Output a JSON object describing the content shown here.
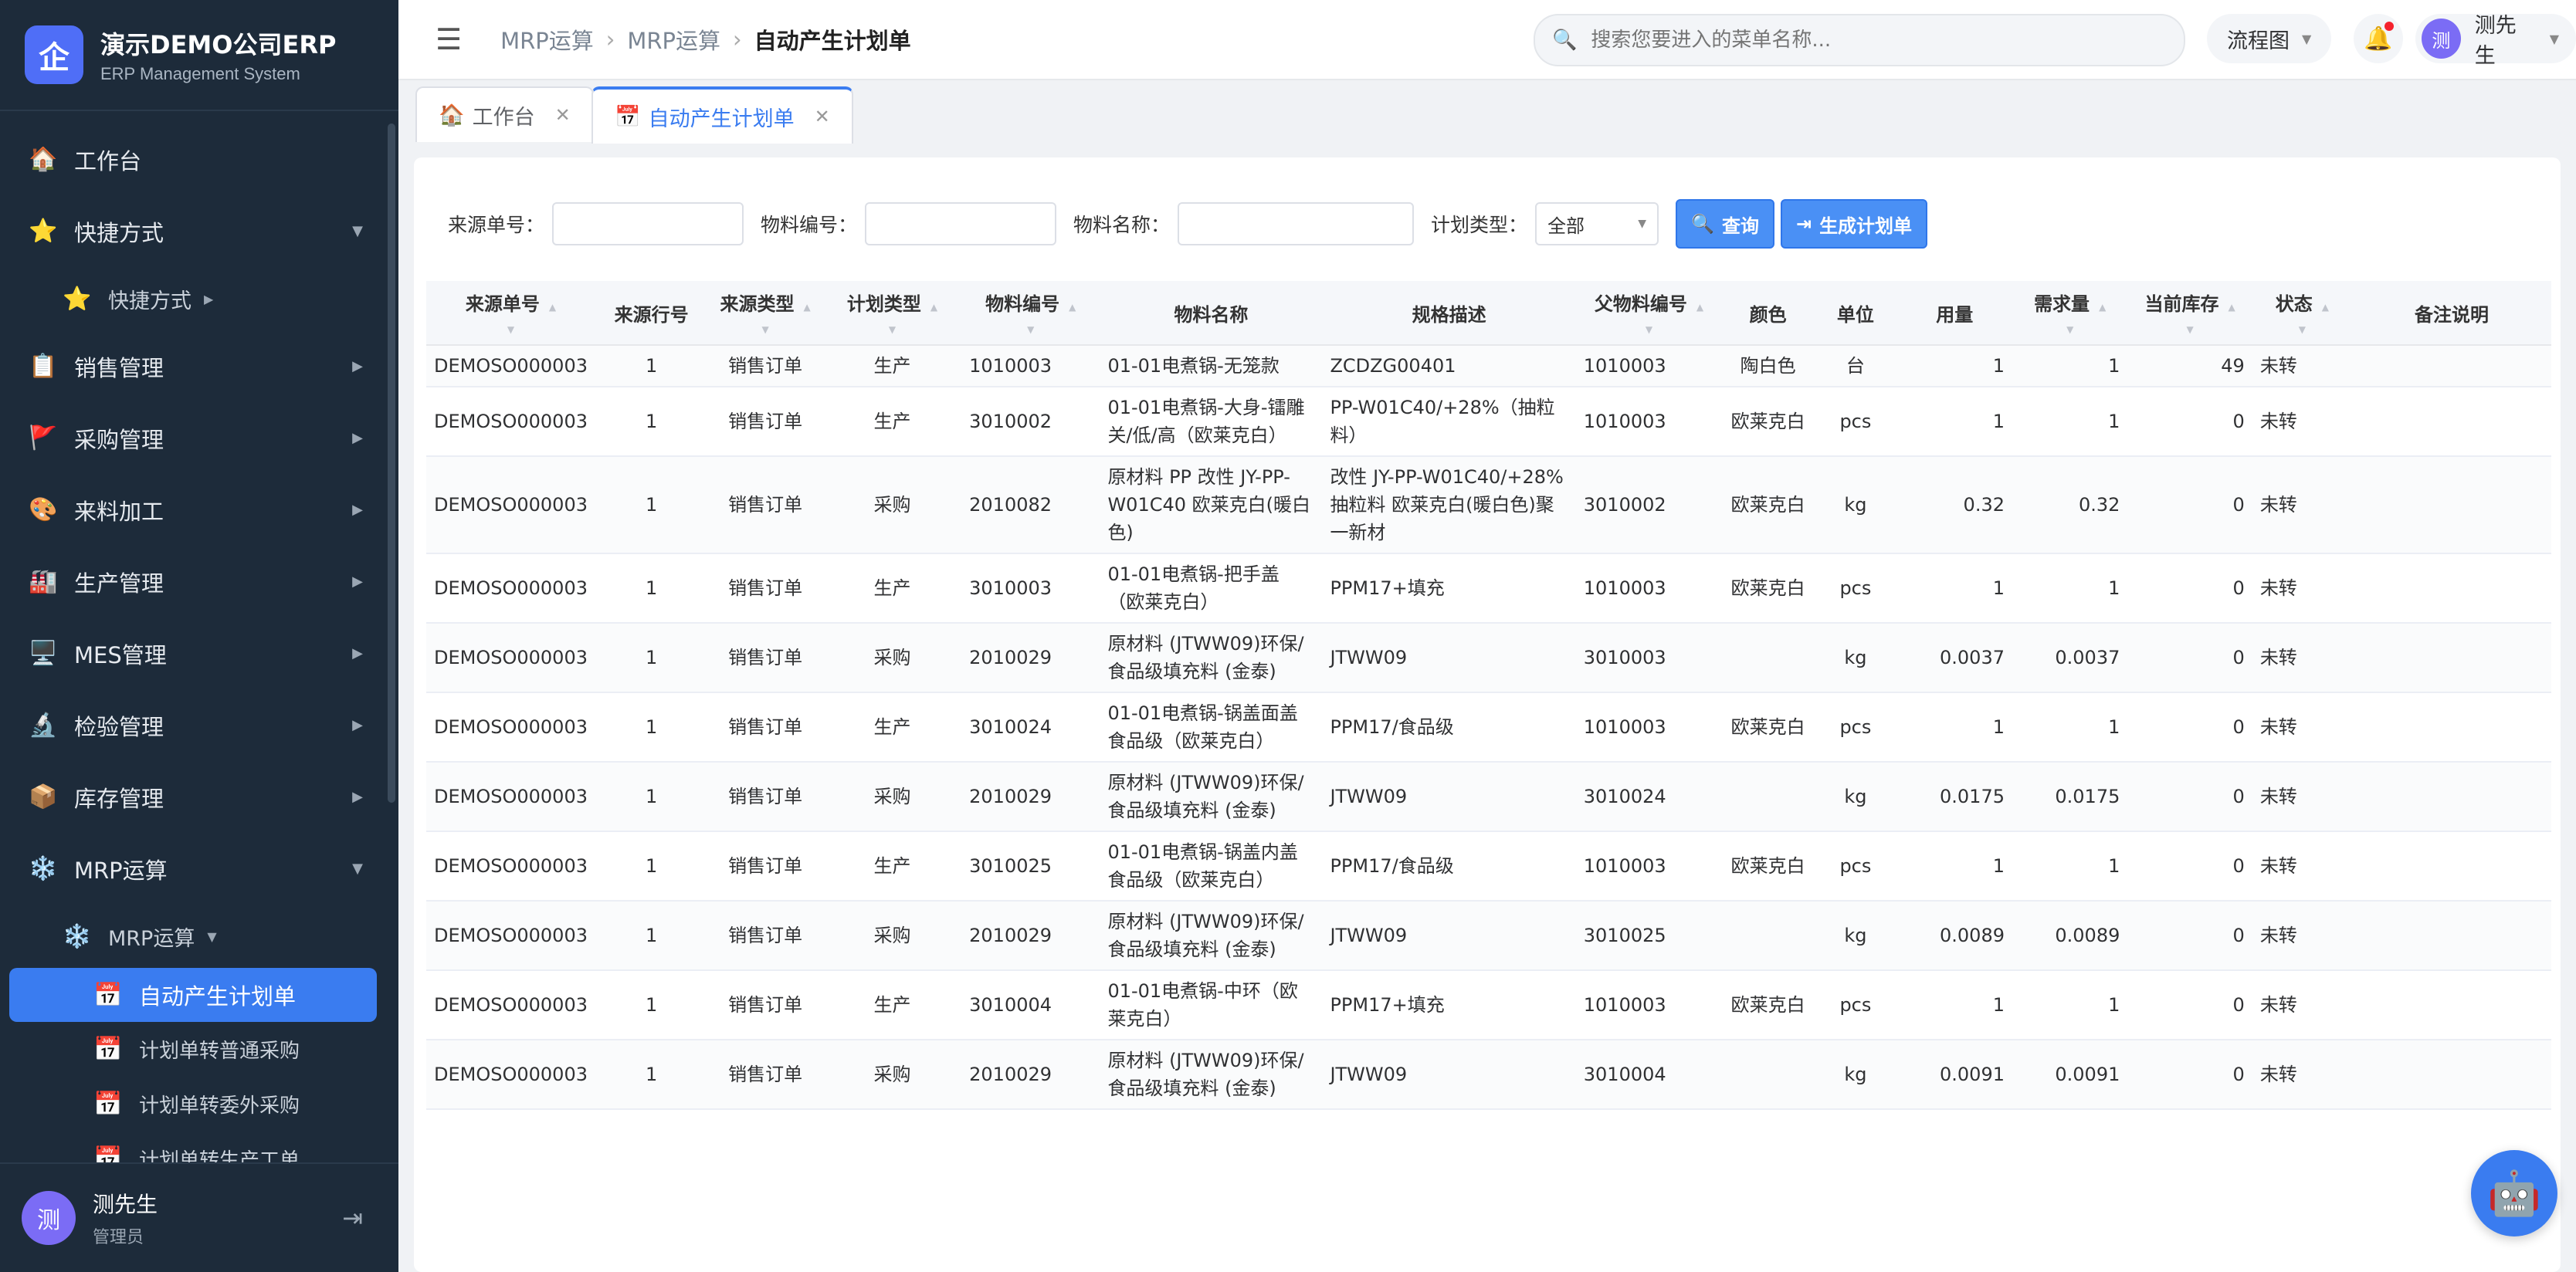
{
  "brand": {
    "logo_char": "企",
    "name": "演示DEMO公司ERP",
    "sub": "ERP Management System"
  },
  "sidebar": {
    "items": [
      {
        "icon": "🏠",
        "label": "工作台"
      },
      {
        "icon": "⭐",
        "label": "快捷方式"
      },
      {
        "icon": "⭐",
        "label": "快捷方式"
      },
      {
        "icon": "📋",
        "label": "销售管理"
      },
      {
        "icon": "🚩",
        "label": "采购管理"
      },
      {
        "icon": "🎨",
        "label": "来料加工"
      },
      {
        "icon": "🏭",
        "label": "生产管理"
      },
      {
        "icon": "🖥️",
        "label": "MES管理"
      },
      {
        "icon": "🔬",
        "label": "检验管理"
      },
      {
        "icon": "📦",
        "label": "库存管理"
      },
      {
        "icon": "❄️",
        "label": "MRP运算"
      },
      {
        "icon": "❄️",
        "label": "MRP运算"
      },
      {
        "icon": "📅",
        "label": "自动产生计划单"
      },
      {
        "icon": "📅",
        "label": "计划单转普通采购"
      },
      {
        "icon": "📅",
        "label": "计划单转委外采购"
      },
      {
        "icon": "📅",
        "label": "计划单转生产工单"
      }
    ],
    "user": {
      "avatar": "测",
      "name": "测先生",
      "role": "管理员"
    }
  },
  "topbar": {
    "breadcrumb": [
      "MRP运算",
      "MRP运算",
      "自动产生计划单"
    ],
    "search_placeholder": "搜索您要进入的菜单名称...",
    "flow_label": "流程图",
    "user_avatar": "测",
    "user_name": "测先生"
  },
  "tabs": [
    {
      "icon": "🏠",
      "label": "工作台"
    },
    {
      "icon": "📅",
      "label": "自动产生计划单"
    }
  ],
  "filters": {
    "source_no_label": "来源单号：",
    "material_no_label": "物料编号：",
    "material_name_label": "物料名称：",
    "plan_type_label": "计划类型：",
    "plan_type_value": "全部",
    "query_button": "查询",
    "generate_button": "生成计划单"
  },
  "table": {
    "headers": [
      "来源单号",
      "来源行号",
      "来源类型",
      "计划类型",
      "物料编号",
      "物料名称",
      "规格描述",
      "父物料编号",
      "颜色",
      "单位",
      "用量",
      "需求量",
      "当前库存",
      "状态",
      "备注说明"
    ],
    "rows": [
      [
        "DEMOSO000003",
        "1",
        "销售订单",
        "生产",
        "1010003",
        "01-01电煮锅-无笼款",
        "ZCDZG00401",
        "1010003",
        "陶白色",
        "台",
        "1",
        "1",
        "49",
        "未转",
        ""
      ],
      [
        "DEMOSO000003",
        "1",
        "销售订单",
        "生产",
        "3010002",
        "01-01电煮锅-大身-镭雕关/低/高（欧莱克白）",
        "PP-W01C40/+28%（抽粒料）",
        "1010003",
        "欧莱克白",
        "pcs",
        "1",
        "1",
        "0",
        "未转",
        ""
      ],
      [
        "DEMOSO000003",
        "1",
        "销售订单",
        "采购",
        "2010082",
        "原材料 PP 改性 JY-PP-W01C40 欧莱克白(暖白色)",
        "改性 JY-PP-W01C40/+28% 抽粒料 欧莱克白(暖白色)聚一新材",
        "3010002",
        "欧莱克白",
        "kg",
        "0.32",
        "0.32",
        "0",
        "未转",
        ""
      ],
      [
        "DEMOSO000003",
        "1",
        "销售订单",
        "生产",
        "3010003",
        "01-01电煮锅-把手盖（欧莱克白）",
        "PPM17+填充",
        "1010003",
        "欧莱克白",
        "pcs",
        "1",
        "1",
        "0",
        "未转",
        ""
      ],
      [
        "DEMOSO000003",
        "1",
        "销售订单",
        "采购",
        "2010029",
        "原材料 (JTWW09)环保/食品级填充料 (金泰)",
        "JTWW09",
        "3010003",
        "",
        "kg",
        "0.0037",
        "0.0037",
        "0",
        "未转",
        ""
      ],
      [
        "DEMOSO000003",
        "1",
        "销售订单",
        "生产",
        "3010024",
        "01-01电煮锅-锅盖面盖 食品级（欧莱克白）",
        "PPM17/食品级",
        "1010003",
        "欧莱克白",
        "pcs",
        "1",
        "1",
        "0",
        "未转",
        ""
      ],
      [
        "DEMOSO000003",
        "1",
        "销售订单",
        "采购",
        "2010029",
        "原材料 (JTWW09)环保/食品级填充料 (金泰)",
        "JTWW09",
        "3010024",
        "",
        "kg",
        "0.0175",
        "0.0175",
        "0",
        "未转",
        ""
      ],
      [
        "DEMOSO000003",
        "1",
        "销售订单",
        "生产",
        "3010025",
        "01-01电煮锅-锅盖内盖 食品级（欧莱克白）",
        "PPM17/食品级",
        "1010003",
        "欧莱克白",
        "pcs",
        "1",
        "1",
        "0",
        "未转",
        ""
      ],
      [
        "DEMOSO000003",
        "1",
        "销售订单",
        "采购",
        "2010029",
        "原材料 (JTWW09)环保/食品级填充料 (金泰)",
        "JTWW09",
        "3010025",
        "",
        "kg",
        "0.0089",
        "0.0089",
        "0",
        "未转",
        ""
      ],
      [
        "DEMOSO000003",
        "1",
        "销售订单",
        "生产",
        "3010004",
        "01-01电煮锅-中环（欧莱克白）",
        "PPM17+填充",
        "1010003",
        "欧莱克白",
        "pcs",
        "1",
        "1",
        "0",
        "未转",
        ""
      ],
      [
        "DEMOSO000003",
        "1",
        "销售订单",
        "采购",
        "2010029",
        "原材料 (JTWW09)环保/食品级填充料 (金泰)",
        "JTWW09",
        "3010004",
        "",
        "kg",
        "0.0091",
        "0.0091",
        "0",
        "未转",
        ""
      ]
    ]
  },
  "colors": {
    "accent": "#3a7cf0",
    "sidebar_bg": "#1d2b3a",
    "button": "#4a90f5"
  }
}
